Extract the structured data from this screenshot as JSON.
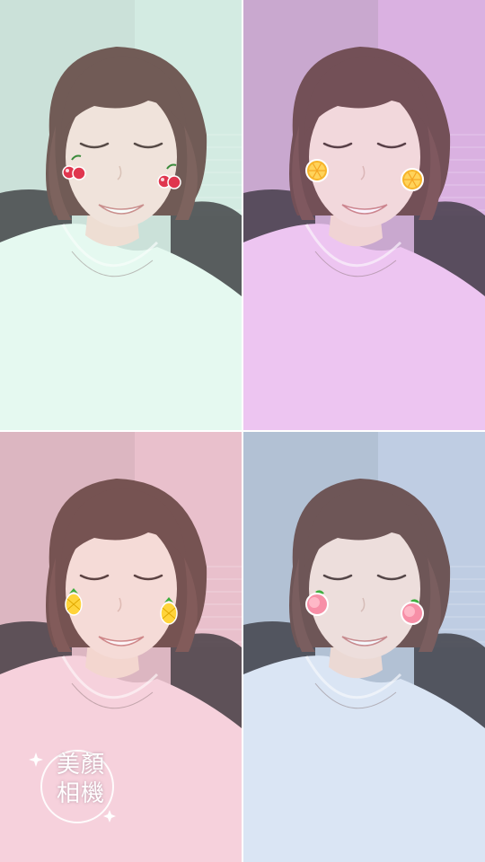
{
  "panels": [
    {
      "filter": "mint",
      "tint": "#d9f3e8",
      "bg": "#c9ddd6",
      "shirt": "#e8faf2",
      "sticker": "cherry-icon"
    },
    {
      "filter": "lavender",
      "tint": "#e6b8ec",
      "bg": "#c4a5c8",
      "shirt": "#f0c8f2",
      "sticker": "orange-slice-icon"
    },
    {
      "filter": "rose",
      "tint": "#f2c6d4",
      "bg": "#d7b3bd",
      "shirt": "#f7d3df",
      "sticker": "pineapple-icon"
    },
    {
      "filter": "sky",
      "tint": "#c8d6ec",
      "bg": "#aebccf",
      "shirt": "#dfe8f6",
      "sticker": "peach-icon"
    }
  ],
  "watermark": {
    "line1": "美顏",
    "line2": "相機"
  }
}
